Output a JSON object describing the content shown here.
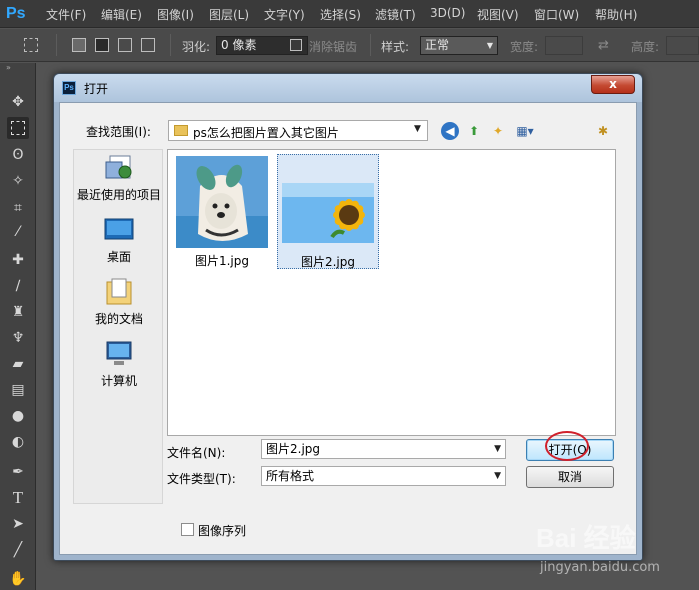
{
  "app": {
    "logo": "Ps",
    "menu": [
      "文件(F)",
      "编辑(E)",
      "图像(I)",
      "图层(L)",
      "文字(Y)",
      "选择(S)",
      "滤镜(T)",
      "3D(D)",
      "视图(V)",
      "窗口(W)",
      "帮助(H)"
    ]
  },
  "options": {
    "feather_label": "羽化:",
    "feather_value": "0 像素",
    "antialias_label": "消除锯齿",
    "style_label": "样式:",
    "style_value": "正常",
    "width_label": "宽度:",
    "height_label": "高度:"
  },
  "tools": [
    "move-tool-icon",
    "marquee-tool-icon",
    "lasso-tool-icon",
    "magic-wand-icon",
    "crop-tool-icon",
    "eyedropper-icon",
    "healing-brush-icon",
    "brush-tool-icon",
    "clone-stamp-icon",
    "history-brush-icon",
    "eraser-icon",
    "gradient-tool-icon",
    "blur-tool-icon",
    "dodge-tool-icon",
    "pen-tool-icon",
    "type-tool-icon",
    "path-select-icon",
    "line-tool-icon",
    "hand-tool-icon"
  ],
  "dialog": {
    "title": "打开",
    "close": "x",
    "lookin_label": "查找范围(I):",
    "lookin_value": "ps怎么把图片置入其它图片",
    "places": [
      {
        "label": "最近使用的项目",
        "icon": "recent-items-icon"
      },
      {
        "label": "桌面",
        "icon": "desktop-icon"
      },
      {
        "label": "我的文档",
        "icon": "my-documents-icon"
      },
      {
        "label": "计算机",
        "icon": "computer-icon"
      }
    ],
    "files": [
      {
        "name": "图片1.jpg",
        "selected": false
      },
      {
        "name": "图片2.jpg",
        "selected": true
      }
    ],
    "filename_label": "文件名(N):",
    "filename_value": "图片2.jpg",
    "filetype_label": "文件类型(T):",
    "filetype_value": "所有格式",
    "open_button": "打开(O)",
    "cancel_button": "取消",
    "sequence_label": "图像序列"
  },
  "watermark": {
    "brand": "Bai 经验",
    "url": "jingyan.baidu.com"
  }
}
